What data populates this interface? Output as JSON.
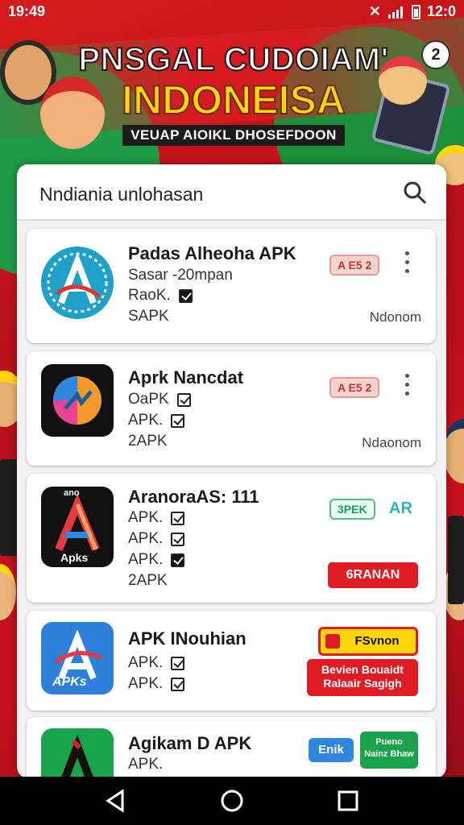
{
  "status_bar": {
    "time": "19:49",
    "right_time": "12:0"
  },
  "banner": {
    "headline_line1": "PNSGAL CUDOIAM'",
    "headline_line2": "INDONEISA",
    "tagline": "VEUAP AIOIKL DHOSEFDOON",
    "close_label": "2"
  },
  "search": {
    "query": "Nndiania unlohasan"
  },
  "apps": [
    {
      "title": "Padas Alheoha APK",
      "lines": [
        "Sasar -20mpan",
        "RaoK.",
        "SAPK"
      ],
      "badge": "A E5 2",
      "meta": "Ndonom"
    },
    {
      "title": "Aprk Nancdat",
      "lines": [
        "OaPK",
        "APK.",
        "2APK"
      ],
      "badge": "A E5 2",
      "meta": "Ndaonom"
    },
    {
      "title": "AranoraAS: 111",
      "lines": [
        "APK.",
        "APK.",
        "APK.",
        "2APK"
      ],
      "badge": "3PEK",
      "badge2": "AR",
      "button": "6RANAN",
      "icon_top": "ano",
      "icon_bottom": "Apks"
    },
    {
      "title": "APK INouhian",
      "lines": [
        "APK.",
        "APK."
      ],
      "ad_top": "FSvnon",
      "ad_bottom_line1": "Bevien Bouaidt",
      "ad_bottom_line2": "Ralaair Sagigh",
      "icon_label": "APKs"
    },
    {
      "title": "Agikam D APK",
      "lines": [
        "APK."
      ],
      "ad_blue": "Enik",
      "ad_green_line1": "Pueno",
      "ad_green_line2": "Nainz Bhaw"
    }
  ],
  "colors": {
    "accent_red": "#e01b24",
    "accent_green": "#1a9c57",
    "sheet_bg": "#f3f1f2"
  },
  "icons": [
    "search-icon",
    "overflow-menu-icon",
    "back-icon",
    "home-icon",
    "recents-icon",
    "battery-icon",
    "signal-icon"
  ]
}
